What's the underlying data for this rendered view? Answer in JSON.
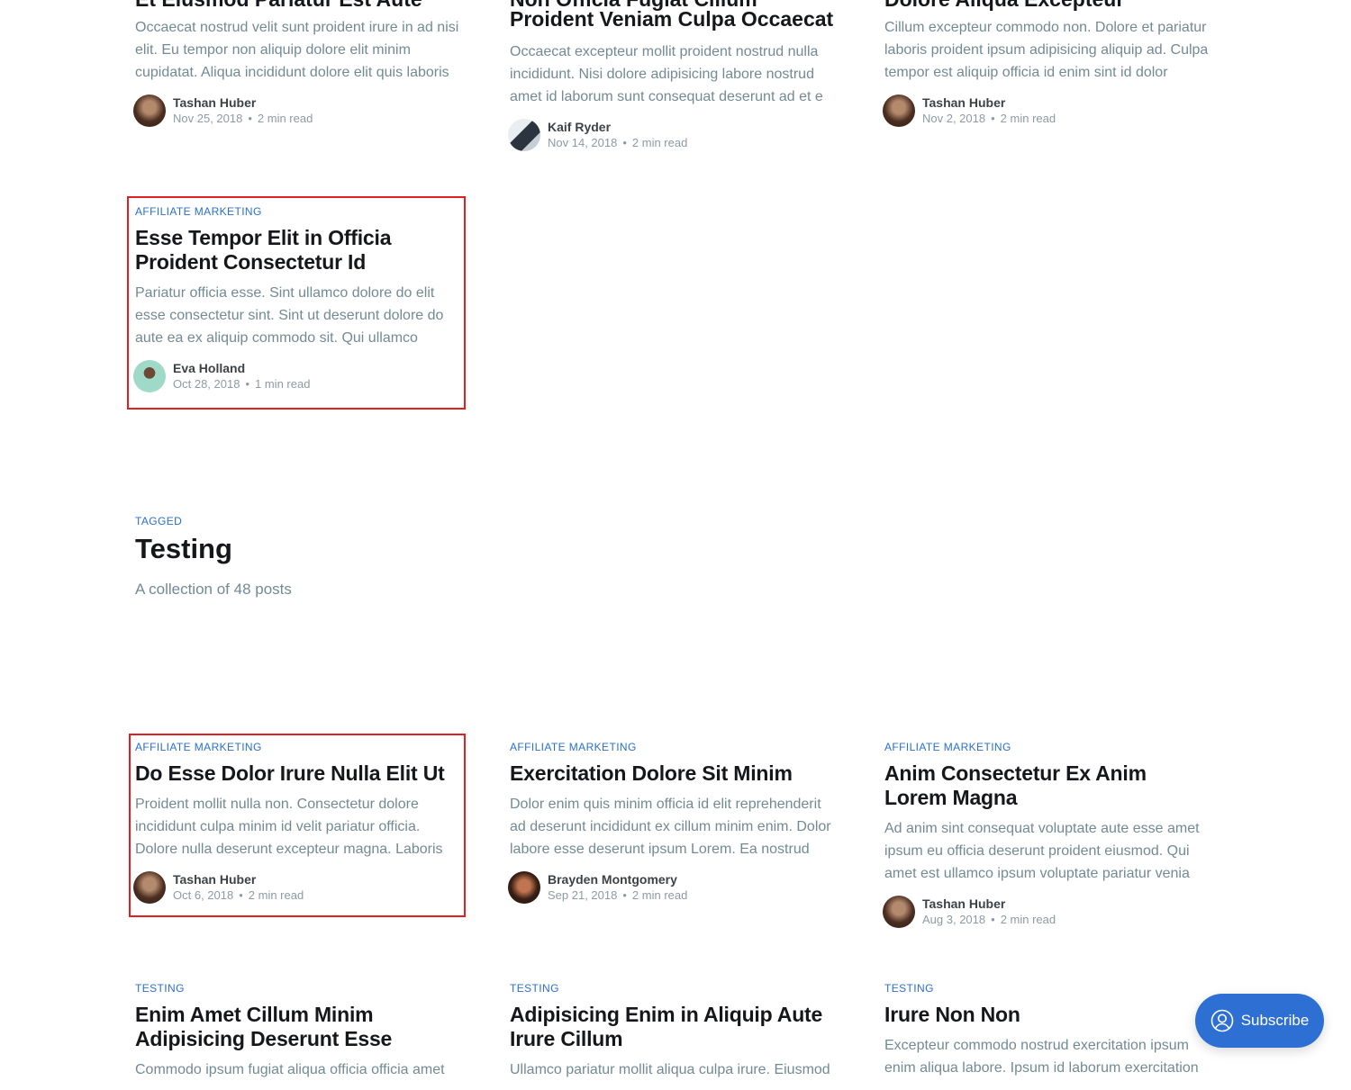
{
  "top_row": [
    {
      "title_tail": "Et Eiusmod Pariatur Est Aute",
      "excerpt": "Occaecat nostrud velit sunt proident irure in ad nisi elit. Eu tempor non aliquip dolore elit minim cupidatat. Aliqua incididunt dolore elit quis laboris",
      "author": "Tashan Huber",
      "date": "Nov 25, 2018",
      "read": "2 min read"
    },
    {
      "title_tail": "Proident Veniam Culpa Occaecat",
      "title_above": "Non Officia Fugiat Cillum",
      "excerpt": "Occaecat excepteur mollit proident nostrud nulla incididunt. Nisi dolore adipisicing labore nostrud amet id laborum sunt consequat deserunt ad et e",
      "author": "Kaif Ryder",
      "date": "Nov 14, 2018",
      "read": "2 min read"
    },
    {
      "title_tail": "Dolore Aliqua Excepteur",
      "excerpt": "Cillum excepteur commodo non. Dolore et pariatur laboris proident ipsum adipisicing aliquip ad. Culpa tempor est aliquip officia id enim sint id dolor",
      "author": "Tashan Huber",
      "date": "Nov 2, 2018",
      "read": "2 min read"
    }
  ],
  "featured": {
    "tag": "AFFILIATE MARKETING",
    "title": "Esse Tempor Elit in Officia Proident Consectetur Id",
    "excerpt": "Pariatur officia esse. Sint ullamco dolore do elit esse consectetur sint. Sint ut deserunt dolore do aute ea ex aliquip commodo sit. Qui ullamco",
    "author": "Eva Holland",
    "date": "Oct 28, 2018",
    "read": "1 min read"
  },
  "tag_header": {
    "label": "TAGGED",
    "title": "Testing",
    "description": "A collection of 48 posts"
  },
  "row2": [
    {
      "tag": "AFFILIATE MARKETING",
      "title": "Do Esse Dolor Irure Nulla Elit Ut",
      "excerpt": "Proident mollit nulla non. Consectetur dolore incididunt culpa minim id velit pariatur officia. Dolore nulla deserunt excepteur magna. Laboris",
      "author": "Tashan Huber",
      "date": "Oct 6, 2018",
      "read": "2 min read"
    },
    {
      "tag": "AFFILIATE MARKETING",
      "title": "Exercitation Dolore Sit Minim",
      "excerpt": "Dolor enim quis minim officia id elit reprehenderit ad deserunt incididunt ex cillum minim enim. Dolor labore esse deserunt ipsum Lorem. Ea nostrud",
      "author": "Brayden Montgomery",
      "date": "Sep 21, 2018",
      "read": "2 min read"
    },
    {
      "tag": "AFFILIATE MARKETING",
      "title": "Anim Consectetur Ex Anim Lorem Magna",
      "excerpt": "Ad anim sint consequat voluptate aute esse amet ipsum eu officia deserunt proident eiusmod. Qui amet est ullamco ipsum voluptate pariatur venia",
      "author": "Tashan Huber",
      "date": "Aug 3, 2018",
      "read": "2 min read"
    }
  ],
  "row3": [
    {
      "tag": "TESTING",
      "title": "Enim Amet Cillum Minim Adipisicing Deserunt Esse",
      "excerpt": "Commodo ipsum fugiat aliqua officia officia amet"
    },
    {
      "tag": "TESTING",
      "title": "Adipisicing Enim in Aliquip Aute Irure Cillum",
      "excerpt": "Ullamco pariatur mollit aliqua culpa irure. Eiusmod"
    },
    {
      "tag": "TESTING",
      "title": "Irure Non Non",
      "excerpt": "Excepteur commodo nostrud exercitation ipsum enim aliqua labore. Ipsum id laborum exercitation"
    }
  ],
  "subscribe": {
    "label": "Subscribe"
  },
  "colors": {
    "accent": "#2a6fd0",
    "highlight": "#e02020",
    "button": "#2e6fd3"
  }
}
